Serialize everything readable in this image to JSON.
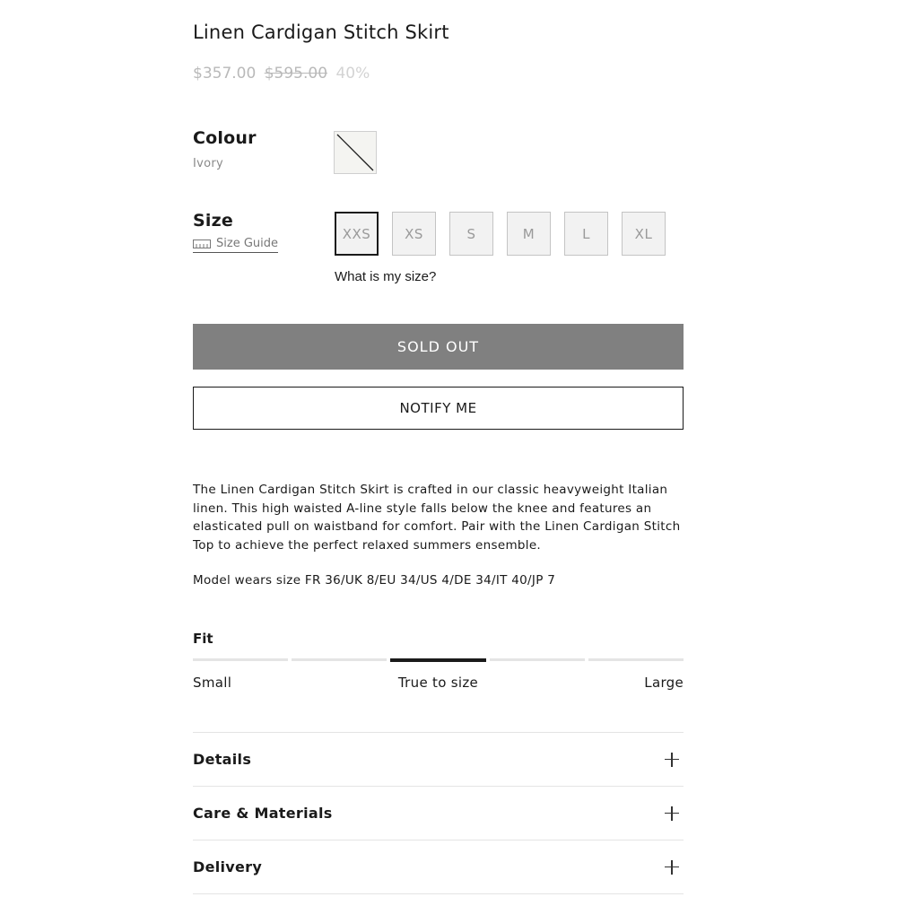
{
  "product": {
    "title": "Linen Cardigan Stitch Skirt",
    "price_current": "$357.00",
    "price_original": "$595.00",
    "discount": "40%"
  },
  "colour": {
    "label": "Colour",
    "selected": "Ivory",
    "swatch_color": "#f4f4f1"
  },
  "size": {
    "label": "Size",
    "guide_label": "Size Guide",
    "options": [
      "XXS",
      "XS",
      "S",
      "M",
      "L",
      "XL"
    ],
    "selected": "XXS",
    "help_link": "What is my size?"
  },
  "actions": {
    "sold_out_label": "SOLD OUT",
    "notify_label": "NOTIFY ME"
  },
  "description": "The Linen Cardigan Stitch Skirt is crafted in our classic heavyweight Italian linen. This high waisted A-line style falls below the knee and features an elasticated pull on waistband for comfort. Pair with the Linen Cardigan Stitch Top to achieve the perfect relaxed summers ensemble.",
  "model_info": "Model wears size FR 36/UK 8/EU 34/US 4/DE 34/IT 40/JP 7",
  "fit": {
    "label": "Fit",
    "segments": 5,
    "active_segment": 3,
    "min_label": "Small",
    "mid_label": "True to size",
    "max_label": "Large"
  },
  "accordion": [
    {
      "title": "Details",
      "icon": "plus-icon"
    },
    {
      "title": "Care & Materials",
      "icon": "plus-icon"
    },
    {
      "title": "Delivery",
      "icon": "plus-icon"
    }
  ]
}
